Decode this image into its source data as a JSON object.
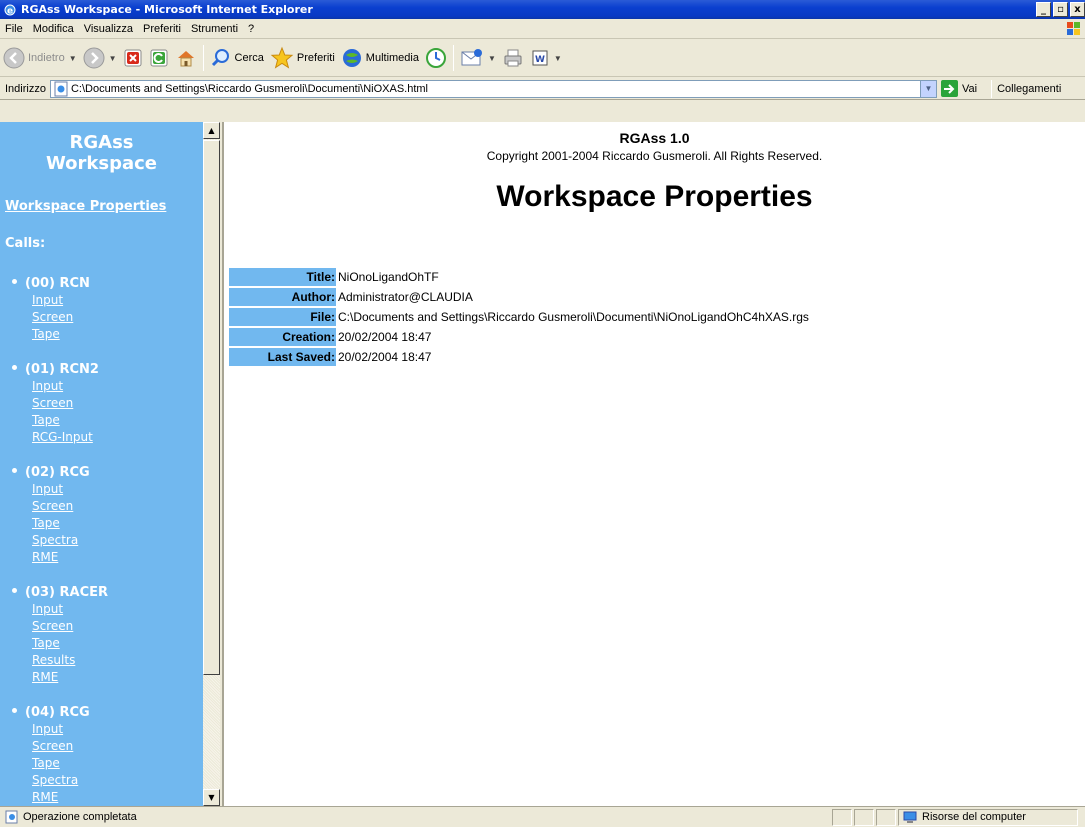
{
  "window": {
    "title": "RGAss Workspace - Microsoft Internet Explorer",
    "min_label": "_",
    "max_label": "▫",
    "close_label": "x"
  },
  "menu": [
    "File",
    "Modifica",
    "Visualizza",
    "Preferiti",
    "Strumenti",
    "?"
  ],
  "toolbar": {
    "back": "Indietro",
    "search": "Cerca",
    "favorites": "Preferiti",
    "media": "Multimedia"
  },
  "address": {
    "label": "Indirizzo",
    "url": "C:\\Documents and Settings\\Riccardo Gusmeroli\\Documenti\\NiOXAS.html",
    "go": "Vai",
    "links": "Collegamenti"
  },
  "sidebar": {
    "brand_line1": "RGAss",
    "brand_line2": "Workspace",
    "properties_link": "Workspace Properties",
    "calls_label": "Calls:",
    "calls": [
      {
        "label": "(00) RCN",
        "links": [
          "Input",
          "Screen",
          "Tape"
        ]
      },
      {
        "label": "(01) RCN2",
        "links": [
          "Input",
          "Screen",
          "Tape",
          "RCG-Input"
        ]
      },
      {
        "label": "(02) RCG",
        "links": [
          "Input",
          "Screen",
          "Tape",
          "Spectra",
          "RME"
        ]
      },
      {
        "label": "(03) RACER",
        "links": [
          "Input",
          "Screen",
          "Tape",
          "Results",
          "RME"
        ]
      },
      {
        "label": "(04) RCG",
        "links": [
          "Input",
          "Screen",
          "Tape",
          "Spectra",
          "RME"
        ]
      }
    ]
  },
  "main": {
    "app_name": "RGAss 1.0",
    "copyright": "Copyright 2001-2004 Riccardo Gusmeroli. All Rights Reserved.",
    "page_title": "Workspace Properties",
    "properties": [
      {
        "key": "Title:",
        "value": "NiOnoLigandOhTF"
      },
      {
        "key": "Author:",
        "value": "Administrator@CLAUDIA"
      },
      {
        "key": "File:",
        "value": "C:\\Documents and Settings\\Riccardo Gusmeroli\\Documenti\\NiOnoLigandOhC4hXAS.rgs"
      },
      {
        "key": "Creation:",
        "value": "20/02/2004 18:47"
      },
      {
        "key": "Last Saved:",
        "value": "20/02/2004 18:47"
      }
    ]
  },
  "status": {
    "message": "Operazione completata",
    "zone": "Risorse del computer"
  },
  "colors": {
    "sidebar_bg": "#71b8ef",
    "titlebar": "#0a3fcf",
    "chrome": "#ece9d8"
  }
}
